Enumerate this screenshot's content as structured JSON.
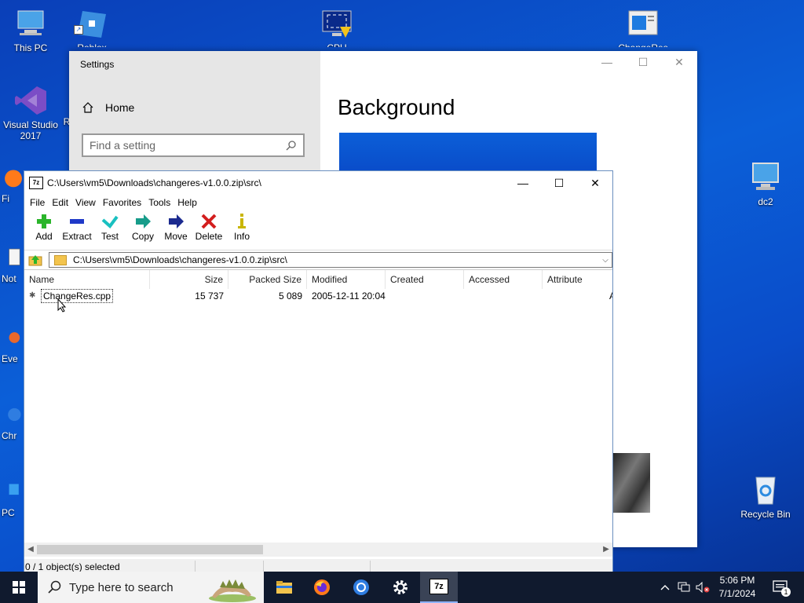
{
  "desktop": {
    "icons": [
      {
        "label": "This PC",
        "icon": "computer-icon"
      },
      {
        "label": "Roblox Studio",
        "icon": "roblox-studio-icon"
      },
      {
        "label": "CPU",
        "icon": "cpu-monitor-icon"
      },
      {
        "label": "ChangeRes",
        "icon": "changeres-icon"
      },
      {
        "label": "Visual Studio 2017",
        "icon": "visual-studio-icon"
      },
      {
        "label": "dc2",
        "icon": "network-computer-icon"
      },
      {
        "label": "Recycle Bin",
        "icon": "recycle-bin-icon"
      },
      {
        "label": "Fi",
        "icon": "firefox-icon"
      },
      {
        "label": "Not",
        "icon": "notepad-icon"
      },
      {
        "label": "Eve",
        "icon": "everything-icon"
      },
      {
        "label": "Chr",
        "icon": "chrome-icon"
      },
      {
        "label": "PC",
        "icon": "pc-icon"
      },
      {
        "label": "R",
        "icon": "r-icon"
      }
    ]
  },
  "settings": {
    "title": "Settings",
    "home_label": "Home",
    "search_placeholder": "Find a setting",
    "page_title": "Background",
    "controls": {
      "minimize": "—",
      "maximize": "☐",
      "close": "✕"
    }
  },
  "zip": {
    "icon_label": "7z",
    "title": "C:\\Users\\vm5\\Downloads\\changeres-v1.0.0.zip\\src\\",
    "controls": {
      "minimize": "—",
      "maximize": "☐",
      "close": "✕"
    },
    "menu": [
      "File",
      "Edit",
      "View",
      "Favorites",
      "Tools",
      "Help"
    ],
    "toolbar": [
      {
        "label": "Add",
        "icon": "add-icon",
        "color": "#2bb52b"
      },
      {
        "label": "Extract",
        "icon": "extract-icon",
        "color": "#1f39c8"
      },
      {
        "label": "Test",
        "icon": "test-icon",
        "color": "#19c0c0"
      },
      {
        "label": "Copy",
        "icon": "copy-icon",
        "color": "#179c8a"
      },
      {
        "label": "Move",
        "icon": "move-icon",
        "color": "#1b2a8f"
      },
      {
        "label": "Delete",
        "icon": "delete-icon",
        "color": "#d31e1e"
      },
      {
        "label": "Info",
        "icon": "info-icon",
        "color": "#c9b500"
      }
    ],
    "address": "C:\\Users\\vm5\\Downloads\\changeres-v1.0.0.zip\\src\\",
    "columns": [
      "Name",
      "Size",
      "Packed Size",
      "Modified",
      "Created",
      "Accessed",
      "Attribute"
    ],
    "rows": [
      {
        "name": "ChangeRes.cpp",
        "size": "15 737",
        "packed": "5 089",
        "modified": "2005-12-11 20:04",
        "created": "",
        "accessed": "",
        "attributes": "A"
      }
    ],
    "status": "0 / 1 object(s) selected"
  },
  "taskbar": {
    "search_placeholder": "Type here to search",
    "apps": [
      {
        "name": "file-explorer",
        "icon": "folder-icon"
      },
      {
        "name": "firefox",
        "icon": "firefox-icon"
      },
      {
        "name": "chrome",
        "icon": "chrome-icon"
      },
      {
        "name": "settings",
        "icon": "gear-icon"
      },
      {
        "name": "7zip",
        "icon": "7zip-icon",
        "label": "7z"
      }
    ],
    "time": "5:06 PM",
    "date": "7/1/2024",
    "notification_count": "1"
  }
}
